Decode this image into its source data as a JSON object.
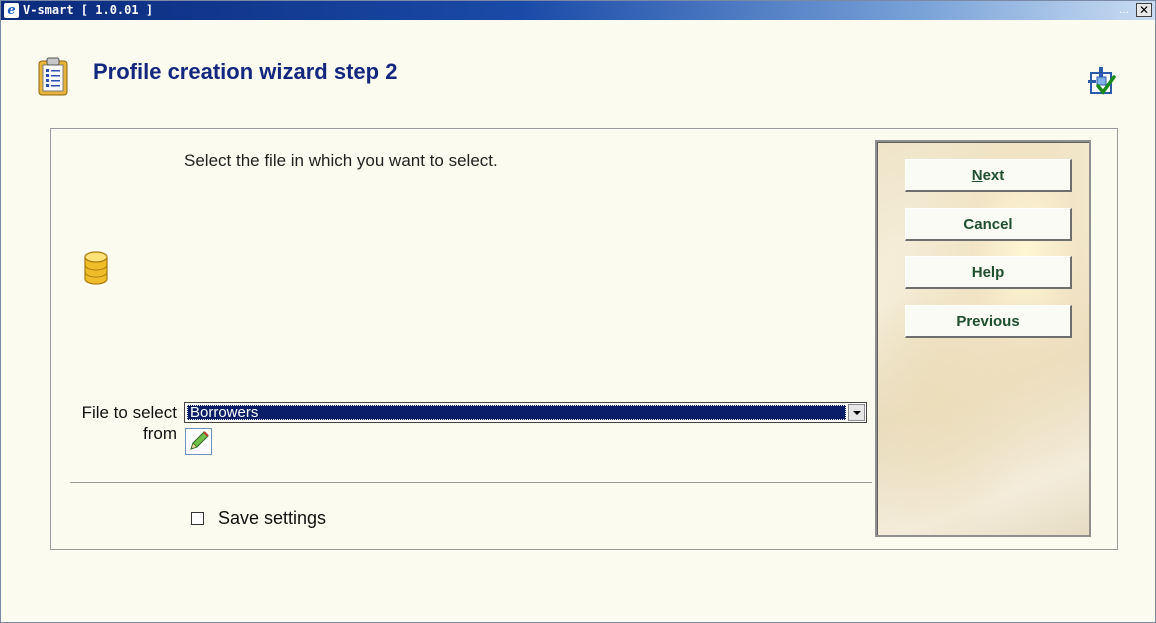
{
  "window": {
    "title": "V-smart [ 1.0.01 ]",
    "title_dots": "...",
    "close_glyph": "✕"
  },
  "header": {
    "title": "Profile creation wizard step 2",
    "left_icon": "clipboard-icon",
    "right_icon": "help-checkmark-icon"
  },
  "main": {
    "instruction": "Select the file in which you want to select.",
    "database_icon": "database-icon",
    "file_field": {
      "label": "File to select from",
      "value": "Borrowers"
    },
    "save_settings": {
      "label": "Save settings",
      "checked": false
    }
  },
  "buttons": {
    "next_label": "Next",
    "next_accesskey": "N",
    "next_rest": "ext",
    "cancel_label": "Cancel",
    "help_label": "Help",
    "previous_label": "Previous"
  },
  "colors": {
    "title_color": "#13277f",
    "button_text": "#1e4f2f",
    "select_highlight": "#0a1e68",
    "titlebar_start": "#0b2a7a"
  }
}
